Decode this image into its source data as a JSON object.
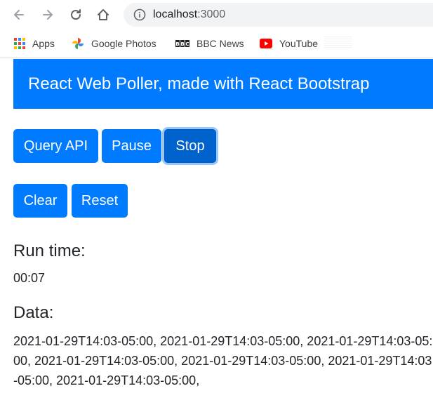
{
  "browser": {
    "url_host": "localhost",
    "url_port": ":3000",
    "bookmarks": [
      {
        "label": "Apps",
        "icon": "apps-grid-icon"
      },
      {
        "label": "Google Photos",
        "icon": "google-photos-icon"
      },
      {
        "label": "BBC News",
        "icon": "bbc-icon"
      },
      {
        "label": "YouTube",
        "icon": "youtube-icon"
      }
    ],
    "bbc_logo_text": "BBC"
  },
  "banner": {
    "title": "React Web Poller, made with React Bootstrap"
  },
  "buttons": {
    "query_api": "Query API",
    "pause": "Pause",
    "stop": "Stop",
    "clear": "Clear",
    "reset": "Reset"
  },
  "run_time": {
    "heading": "Run time:",
    "value": "00:07"
  },
  "data_section": {
    "heading": "Data:",
    "value": "2021-01-29T14:03-05:00, 2021-01-29T14:03-05:00, 2021-01-29T14:03-05:00, 2021-01-29T14:03-05:00, 2021-01-29T14:03-05:00, 2021-01-29T14:03-05:00, 2021-01-29T14:03-05:00,"
  },
  "colors": {
    "primary": "#007bff",
    "primary_active": "#0062cc",
    "text": "#212529"
  }
}
